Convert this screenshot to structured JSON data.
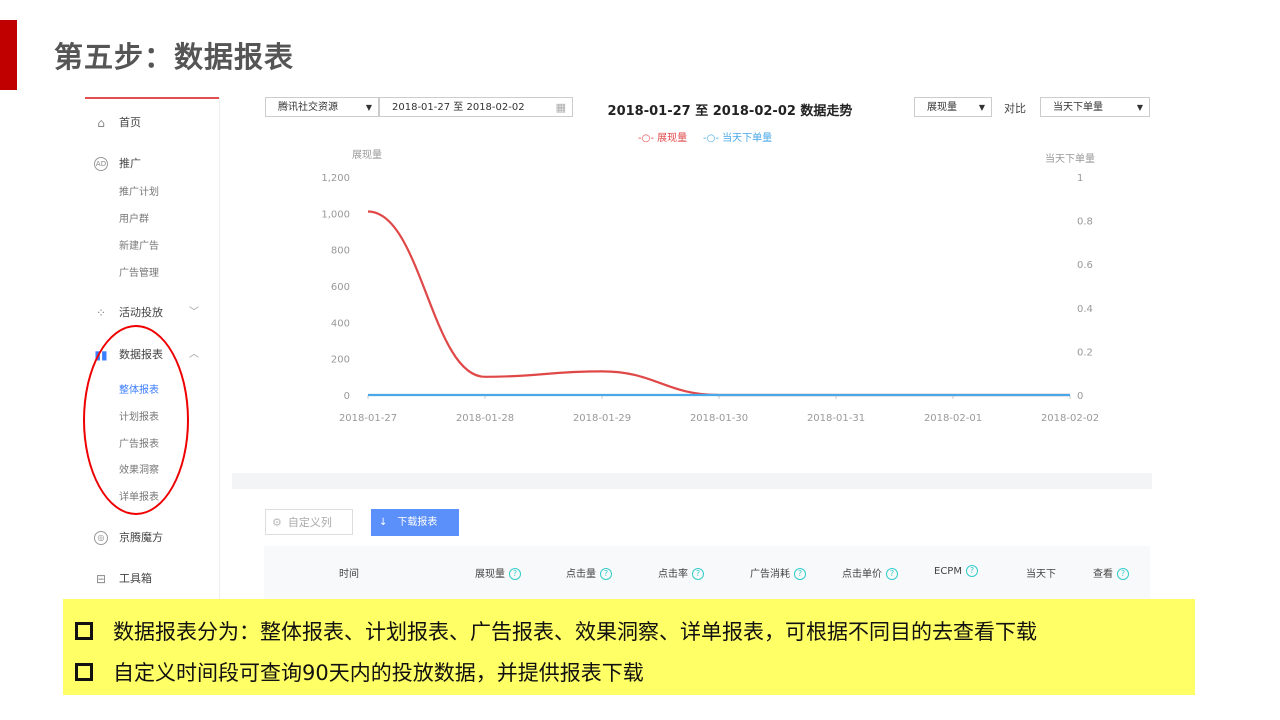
{
  "slide": {
    "title": "第五步：数据报表"
  },
  "sidebar": {
    "home": "首页",
    "promo": "推广",
    "promo_subs": [
      "推广计划",
      "用户群",
      "新建广告",
      "广告管理"
    ],
    "activity": "活动投放",
    "reports": "数据报表",
    "report_subs": [
      "整体报表",
      "计划报表",
      "广告报表",
      "效果洞察",
      "详单报表"
    ],
    "jingteng": "京腾魔方",
    "toolbox": "工具箱"
  },
  "filters": {
    "source": "腾讯社交资源",
    "date_range": "2018-01-27 至 2018-02-02",
    "metric": "展现量",
    "compare_label": "对比",
    "compare_metric": "当天下单量"
  },
  "chart_data": {
    "type": "line",
    "title": "2018-01-27 至 2018-02-02 数据走势",
    "categories": [
      "2018-01-27",
      "2018-01-28",
      "2018-01-29",
      "2018-01-30",
      "2018-01-31",
      "2018-02-01",
      "2018-02-02"
    ],
    "series": [
      {
        "name": "展现量",
        "axis": "left",
        "color": "#e04848",
        "values": [
          1010,
          100,
          130,
          0,
          0,
          0,
          0
        ]
      },
      {
        "name": "当天下单量",
        "axis": "right",
        "color": "#4aa8e8",
        "values": [
          0,
          0,
          0,
          0,
          0,
          0,
          0
        ]
      }
    ],
    "y_left": {
      "label": "展现量",
      "range": [
        0,
        1200
      ],
      "ticks": [
        "0",
        "200",
        "400",
        "600",
        "800",
        "1,000",
        "1,200"
      ]
    },
    "y_right": {
      "label": "当天下单量",
      "range": [
        0,
        1
      ],
      "ticks": [
        "0",
        "0.2",
        "0.4",
        "0.6",
        "0.8",
        "1"
      ]
    },
    "legend": "top-center",
    "grid": false
  },
  "table": {
    "custom_columns": "自定义列",
    "download": "下载报表",
    "headers": [
      "时间",
      "展现量",
      "点击量",
      "点击率",
      "广告消耗",
      "点击单价",
      "ECPM",
      "当天下",
      "查看"
    ]
  },
  "notes": [
    "数据报表分为：整体报表、计划报表、广告报表、效果洞察、详单报表，可根据不同目的去查看下载",
    "自定义时间段可查询90天内的投放数据，并提供报表下载"
  ]
}
